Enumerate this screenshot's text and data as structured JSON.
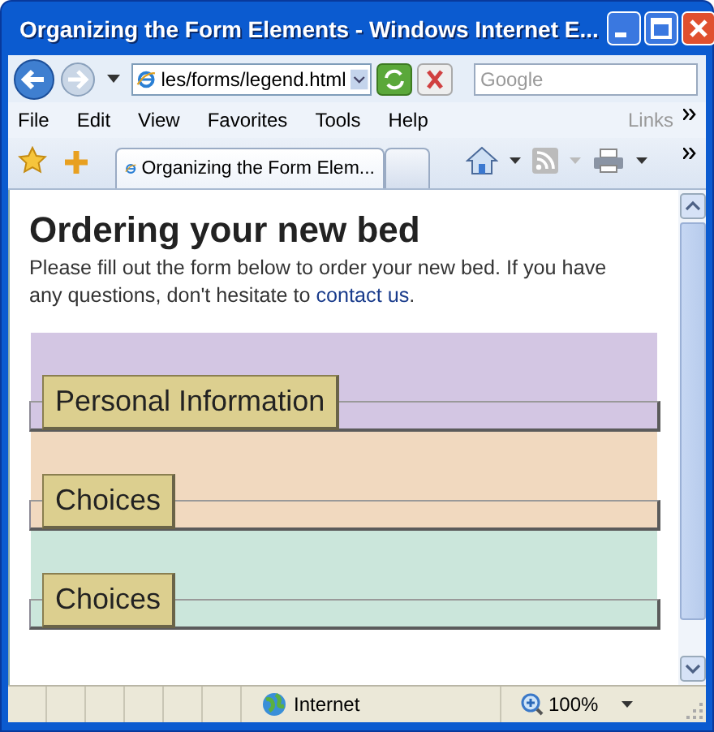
{
  "window": {
    "title": "Organizing the Form Elements - Windows Internet E..."
  },
  "address_bar": {
    "value": "les/forms/legend.html"
  },
  "search": {
    "placeholder": "Google"
  },
  "menu": [
    "File",
    "Edit",
    "View",
    "Favorites",
    "Tools",
    "Help"
  ],
  "links_label": "Links",
  "tabs": [
    {
      "label": "Organizing the Form Elem...",
      "selected": true
    },
    {
      "selected": false
    }
  ],
  "page": {
    "heading": "Ordering your new bed",
    "intro": {
      "before": "Please fill out the form below to order your new bed. If you have any questions, don't hesitate to ",
      "link": "contact us",
      "after": "."
    },
    "fieldsets": [
      {
        "legend": "Personal Information",
        "color": "#d3c6e3"
      },
      {
        "legend": "Choices",
        "color": "#f1d9bf"
      },
      {
        "legend": "Choices",
        "color": "#cbe6db"
      }
    ]
  },
  "status_bar": {
    "zone": "Internet",
    "zoom": "100%"
  }
}
